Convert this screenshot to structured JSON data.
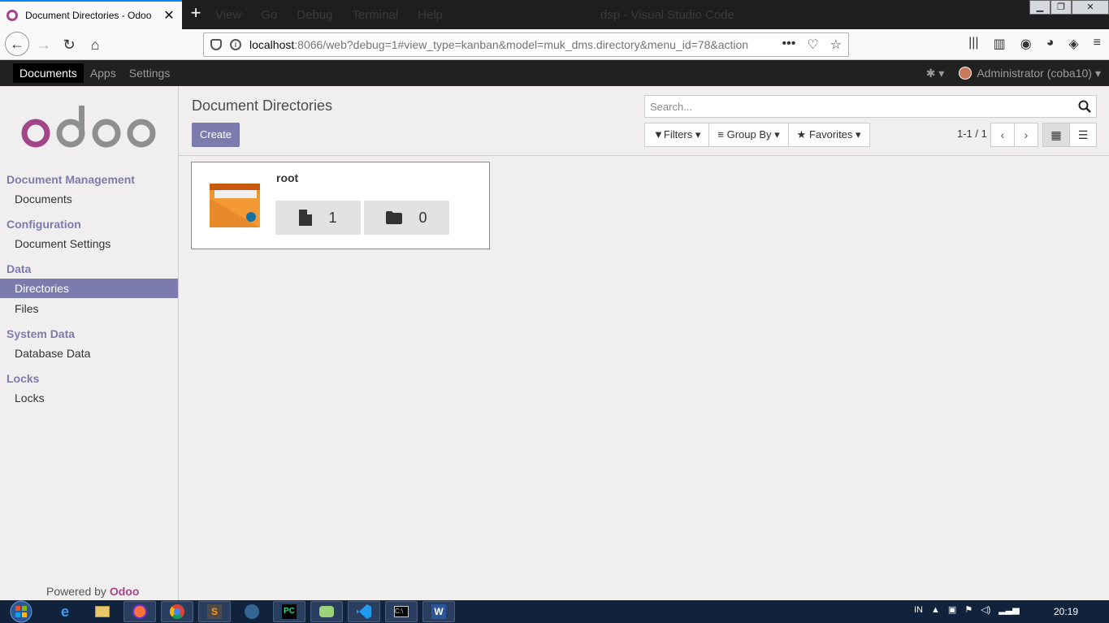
{
  "browser": {
    "tab_title": "Document Directories - Odoo",
    "tab_close": "✕",
    "new_tab": "+",
    "background_menu": [
      "View",
      "Go",
      "Debug",
      "Terminal",
      "Help",
      "dsp - Visual Studio Code"
    ],
    "url_host": "localhost",
    "url_rest": ":8066/web?debug=1#view_type=kanban&model=muk_dms.directory&menu_id=78&action"
  },
  "odoo": {
    "menu": [
      "Documents",
      "Apps",
      "Settings"
    ],
    "user": "Administrator (coba10)"
  },
  "sidebar": {
    "sections": [
      {
        "title": "Document Management",
        "items": [
          "Documents"
        ]
      },
      {
        "title": "Configuration",
        "items": [
          "Document Settings"
        ]
      },
      {
        "title": "Data",
        "items": [
          "Directories",
          "Files"
        ]
      },
      {
        "title": "System Data",
        "items": [
          "Database Data"
        ]
      },
      {
        "title": "Locks",
        "items": [
          "Locks"
        ]
      }
    ],
    "active_item": "Directories",
    "powered_by": "Powered by",
    "powered_brand": "Odoo"
  },
  "control_panel": {
    "title": "Document Directories",
    "create": "Create",
    "search_placeholder": "Search...",
    "filters": "Filters",
    "group_by": "Group By",
    "favorites": "Favorites",
    "pager": "1-1 / 1"
  },
  "kanban": {
    "records": [
      {
        "name": "root",
        "files": "1",
        "directories": "0"
      }
    ]
  },
  "taskbar": {
    "lang": "IN",
    "clock": "20:19"
  },
  "colors": {
    "odoo_primary": "#7c7bad",
    "odoo_brand": "#a24689",
    "folder_orange": "#f0922f",
    "taskbar": "#10223c"
  }
}
